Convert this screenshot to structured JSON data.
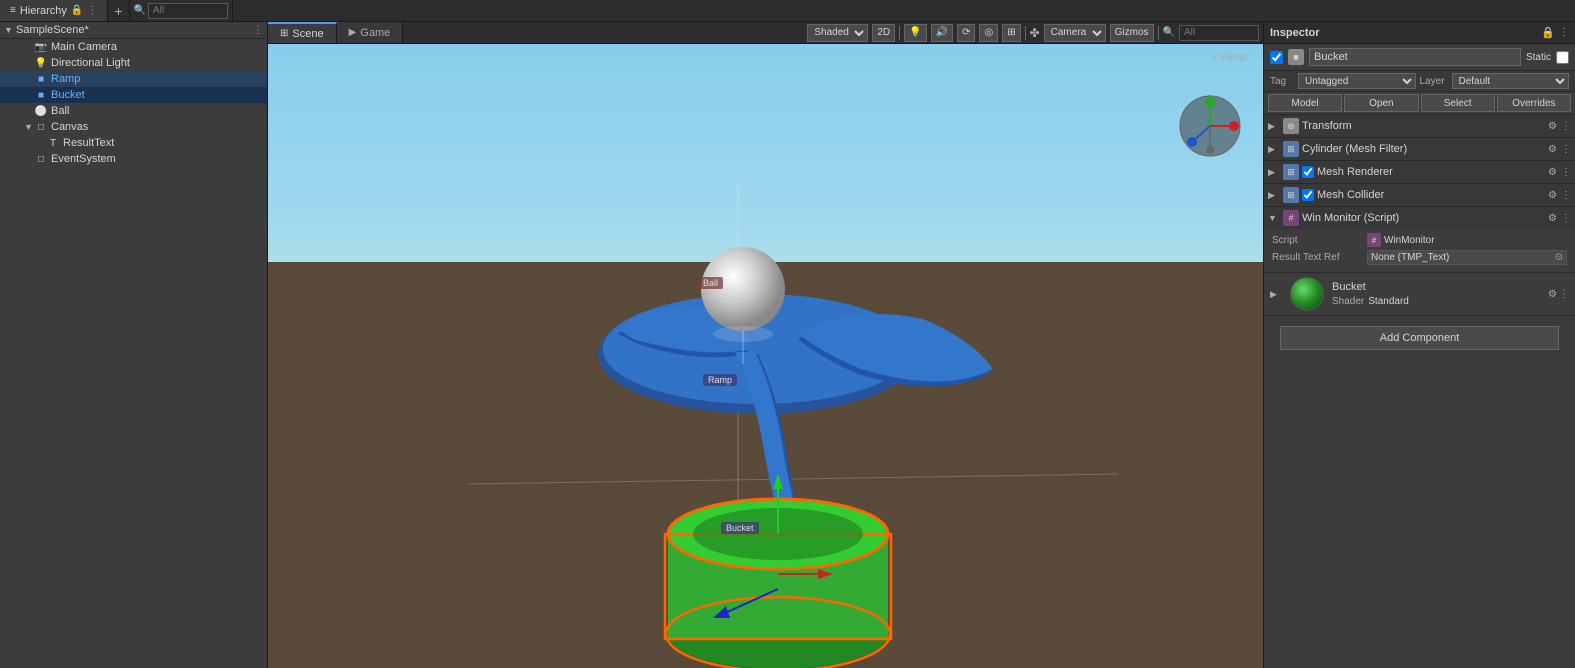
{
  "panels": {
    "hierarchy": {
      "title": "Hierarchy",
      "search_placeholder": "All",
      "scene_name": "SampleScene*",
      "items": [
        {
          "label": "Main Camera",
          "type": "camera",
          "indent": 1,
          "expanded": false
        },
        {
          "label": "Directional Light",
          "type": "light",
          "indent": 1,
          "expanded": false
        },
        {
          "label": "Ramp",
          "type": "cube",
          "indent": 1,
          "expanded": false,
          "highlight": "blue"
        },
        {
          "label": "Bucket",
          "type": "cube",
          "indent": 1,
          "expanded": false,
          "highlight": "blue",
          "selected": true
        },
        {
          "label": "Ball",
          "type": "sphere",
          "indent": 1,
          "expanded": false
        },
        {
          "label": "Canvas",
          "type": "canvas",
          "indent": 1,
          "expanded": true
        },
        {
          "label": "ResultText",
          "type": "text",
          "indent": 2,
          "expanded": false
        },
        {
          "label": "EventSystem",
          "type": "event",
          "indent": 1,
          "expanded": false
        }
      ]
    },
    "scene": {
      "tabs": [
        {
          "label": "Scene",
          "active": true,
          "icon": "grid"
        },
        {
          "label": "Game",
          "active": false,
          "icon": "game"
        }
      ],
      "toolbar": {
        "shading_mode": "Shaded",
        "toggle_2d": "2D",
        "gizmos_label": "Gizmos",
        "search_placeholder": "All"
      },
      "view_label": "< Persp",
      "objects": {
        "ball_label": "Ball",
        "ramp_label": "Ramp",
        "bucket_label": "Bucket"
      }
    },
    "inspector": {
      "title": "Inspector",
      "object_name": "Bucket",
      "static_label": "Static",
      "tag_label": "Tag",
      "tag_value": "Untagged",
      "layer_label": "Layer",
      "layer_value": "Default",
      "buttons": {
        "model": "Model",
        "open": "Open",
        "select": "Select",
        "overrides": "Overrides"
      },
      "components": [
        {
          "name": "Transform",
          "icon": "transform",
          "enabled": true,
          "expanded": true
        },
        {
          "name": "Cylinder (Mesh Filter)",
          "icon": "mesh_filter",
          "enabled": true,
          "expanded": false
        },
        {
          "name": "Mesh Renderer",
          "icon": "mesh_renderer",
          "enabled": true,
          "checked": true,
          "expanded": false
        },
        {
          "name": "Mesh Collider",
          "icon": "mesh_collider",
          "enabled": true,
          "checked": true,
          "expanded": false
        },
        {
          "name": "Win Monitor (Script)",
          "icon": "script",
          "enabled": true,
          "expanded": true,
          "fields": [
            {
              "label": "Script",
              "value": "WinMonitor"
            },
            {
              "label": "Result Text Ref",
              "value": "None (TMP_Text)"
            }
          ]
        }
      ],
      "material": {
        "name": "Bucket",
        "shader": "Standard"
      },
      "add_component": "Add Component"
    }
  }
}
